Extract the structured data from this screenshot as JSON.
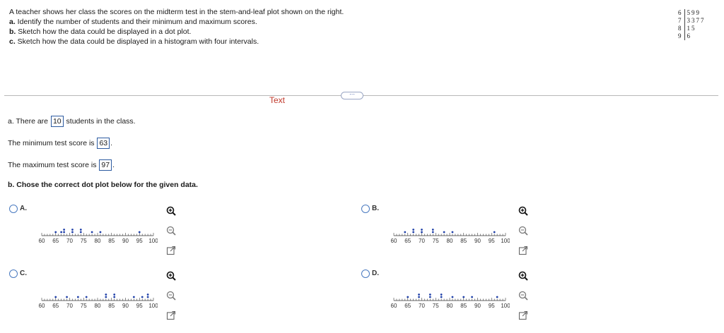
{
  "problem": {
    "intro": "A teacher shows her class the scores on the midterm test in the stem-and-leaf plot shown on the right.",
    "a_label": "a.",
    "a_text": " Identify the number of students and their minimum and maximum scores.",
    "b_label": "b.",
    "b_text": " Sketch how the data could be displayed in a dot plot.",
    "c_label": "c.",
    "c_text": " Sketch how the data could be displayed in a histogram with four intervals."
  },
  "stem_leaf": [
    {
      "stem": "6",
      "leaves": "599"
    },
    {
      "stem": "7",
      "leaves": "3377"
    },
    {
      "stem": "8",
      "leaves": "15"
    },
    {
      "stem": "9",
      "leaves": "6"
    }
  ],
  "toolbar": {
    "more": "⋯",
    "text_tab": "Text"
  },
  "answers": {
    "students_pre": "a. There are",
    "students_val": "10",
    "students_post": "students in the class.",
    "min_pre": "The minimum test score is",
    "min_val": "63",
    "max_pre": "The maximum test score is",
    "max_val": "97",
    "b_prompt": "b. Chose the correct dot plot below for the given data."
  },
  "options": [
    {
      "label": "A.",
      "dots": [
        [
          65,
          1
        ],
        [
          67,
          1
        ],
        [
          68,
          2
        ],
        [
          71,
          2
        ],
        [
          74,
          2
        ],
        [
          78,
          1
        ],
        [
          81,
          1
        ],
        [
          95,
          1
        ]
      ]
    },
    {
      "label": "B.",
      "dots": [
        [
          64,
          1
        ],
        [
          67,
          2
        ],
        [
          70,
          2
        ],
        [
          74,
          2
        ],
        [
          78,
          1
        ],
        [
          81,
          1
        ],
        [
          96,
          1
        ]
      ]
    },
    {
      "label": "C.",
      "dots": [
        [
          65,
          1
        ],
        [
          69,
          1
        ],
        [
          73,
          1
        ],
        [
          76,
          1
        ],
        [
          83,
          2
        ],
        [
          86,
          2
        ],
        [
          93,
          1
        ],
        [
          96,
          1
        ],
        [
          98,
          2
        ]
      ]
    },
    {
      "label": "D.",
      "dots": [
        [
          65,
          1
        ],
        [
          69,
          2
        ],
        [
          73,
          2
        ],
        [
          77,
          2
        ],
        [
          81,
          1
        ],
        [
          85,
          1
        ],
        [
          88,
          1
        ],
        [
          97,
          1
        ]
      ]
    }
  ],
  "axis_ticks": [
    "60",
    "65",
    "70",
    "75",
    "80",
    "85",
    "90",
    "95",
    "100"
  ],
  "colors": {
    "dot": "#1e3fa8",
    "accent": "#2c5aa0",
    "text_tab": "#c0392b"
  }
}
